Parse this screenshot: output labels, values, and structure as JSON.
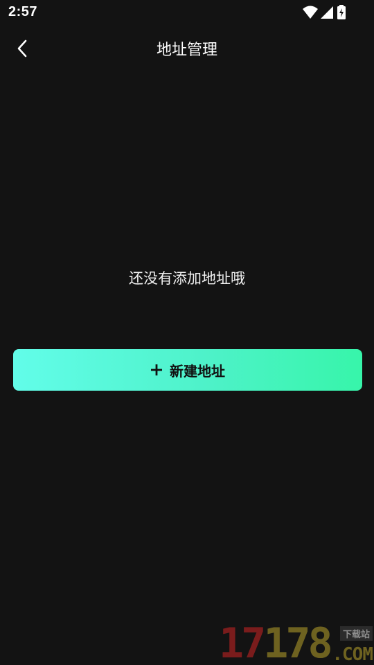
{
  "status_bar": {
    "time": "2:57",
    "icons": [
      "wifi-icon",
      "signal-icon",
      "battery-charging-icon"
    ]
  },
  "header": {
    "back_icon": "chevron-left-icon",
    "title": "地址管理"
  },
  "empty_state": {
    "message": "还没有添加地址哦"
  },
  "add_button": {
    "icon": "plus-icon",
    "label": "新建地址",
    "gradient_start": "#62fde9",
    "gradient_end": "#37f5aa"
  },
  "watermark": {
    "digits_red": "17",
    "digits_gold": "178",
    "tag": "下载站",
    "domain": ".COM"
  },
  "colors": {
    "background": "#131313",
    "text": "#ffffff"
  }
}
